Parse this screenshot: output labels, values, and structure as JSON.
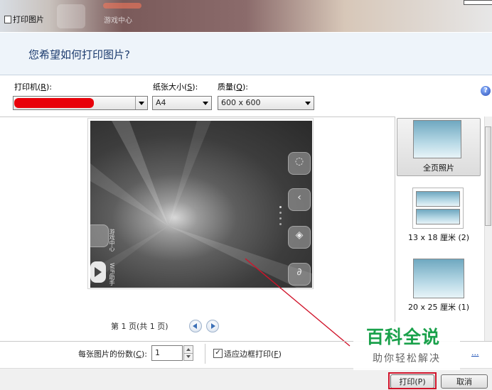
{
  "window": {
    "title": "打印图片",
    "background_text": "游戏中心"
  },
  "header": {
    "heading": "您希望如何打印图片?"
  },
  "printer": {
    "label_pre": "打印机(",
    "label_key": "R",
    "label_post": "):"
  },
  "paper_size": {
    "label_pre": "纸张大小(",
    "label_key": "S",
    "label_post": "):",
    "value": "A4"
  },
  "quality": {
    "label_pre": "质量(",
    "label_key": "Q",
    "label_post": "):",
    "value": "600 x 600"
  },
  "help": {
    "glyph": "?"
  },
  "preview": {
    "side_labels": [
      "游戏中心",
      "WiFi助手"
    ],
    "page_info": "第 1 页(共 1 页)"
  },
  "layouts": [
    {
      "label": "全页照片",
      "selected": true
    },
    {
      "label": "13 x 18 厘米 (2)",
      "selected": false
    },
    {
      "label": "20 x 25 厘米 (1)",
      "selected": false
    }
  ],
  "copies": {
    "label_pre": "每张图片的份数(",
    "label_key": "C",
    "label_post": "):",
    "value": "1"
  },
  "fit": {
    "checked": true,
    "label_pre": "适应边框打印(",
    "label_key": "F",
    "label_post": ")"
  },
  "options_link": "...",
  "buttons": {
    "print": "打印(P)",
    "cancel": "取消"
  },
  "watermark": {
    "title": "百科全说",
    "subtitle": "助你轻松解决"
  },
  "colors": {
    "heading": "#1c3b6e",
    "watermark_green": "#1aa14b",
    "highlight_red": "#d0132a"
  }
}
